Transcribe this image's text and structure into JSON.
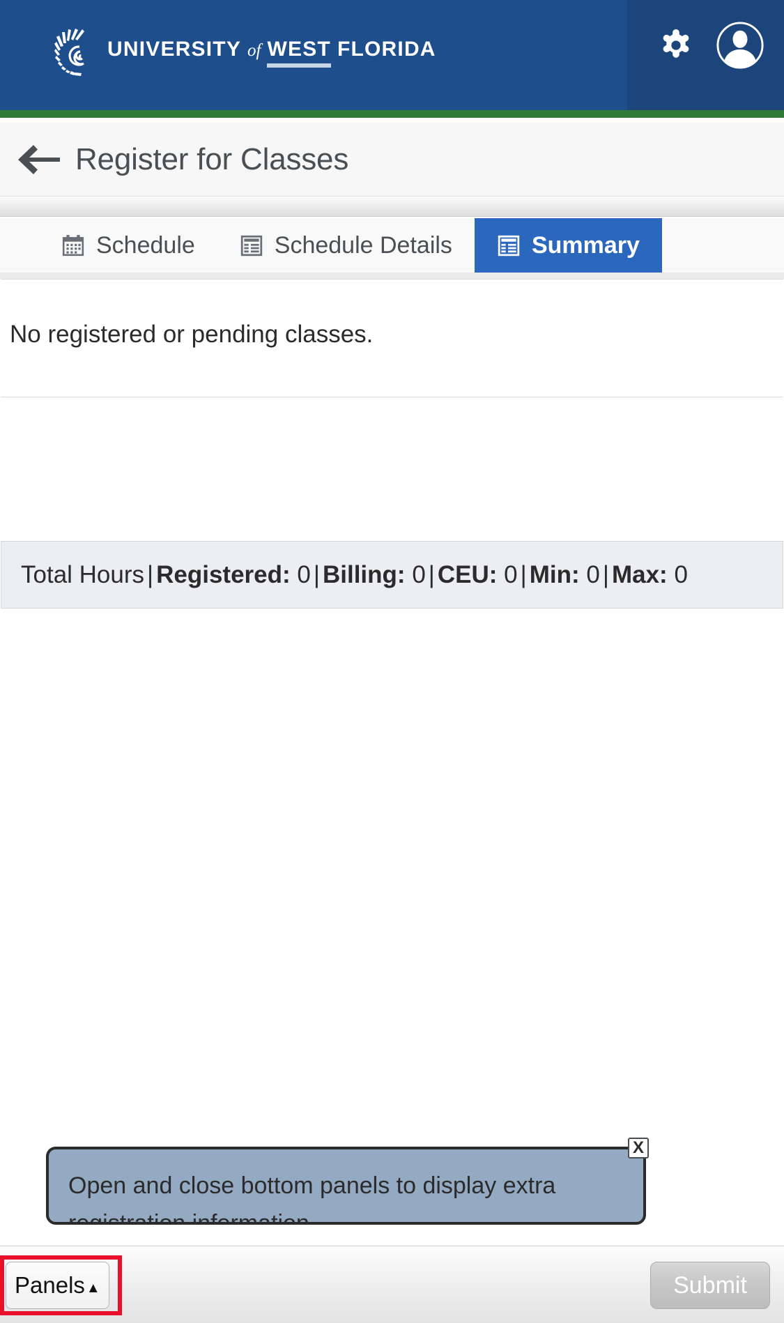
{
  "header": {
    "logo": {
      "icon": "nautilus-shell-icon",
      "word1": "UNIVERSITY",
      "word_of": "of",
      "word2": "WEST",
      "word3": "FLORIDA"
    },
    "settings_icon": "gear-icon",
    "profile_icon": "user-avatar-icon",
    "bg_color": "#1f4e8c",
    "panel_color": "#1c457c",
    "accent_stripe_color": "#2f7a36"
  },
  "page": {
    "back_icon": "back-arrow-icon",
    "title": "Register for Classes"
  },
  "tabs": [
    {
      "label": "Schedule",
      "icon": "calendar-icon",
      "active": false
    },
    {
      "label": "Schedule Details",
      "icon": "table-list-icon",
      "active": false
    },
    {
      "label": "Summary",
      "icon": "table-list-icon",
      "active": true
    }
  ],
  "summary": {
    "empty_message": "No registered or pending classes."
  },
  "totals": {
    "label": "Total Hours",
    "items": [
      {
        "name": "Registered:",
        "value": "0"
      },
      {
        "name": "Billing:",
        "value": "0"
      },
      {
        "name": "CEU:",
        "value": "0"
      },
      {
        "name": "Min:",
        "value": "0"
      },
      {
        "name": "Max:",
        "value": "0"
      }
    ],
    "separator": "|"
  },
  "tooltip": {
    "text": "Open and close bottom panels to display extra registration information.",
    "close_label": "X",
    "bg_color": "#94aac2"
  },
  "bottom_bar": {
    "panels_label": "Panels",
    "panels_caret": "▲",
    "submit_label": "Submit",
    "highlight_color": "#e8102a"
  }
}
